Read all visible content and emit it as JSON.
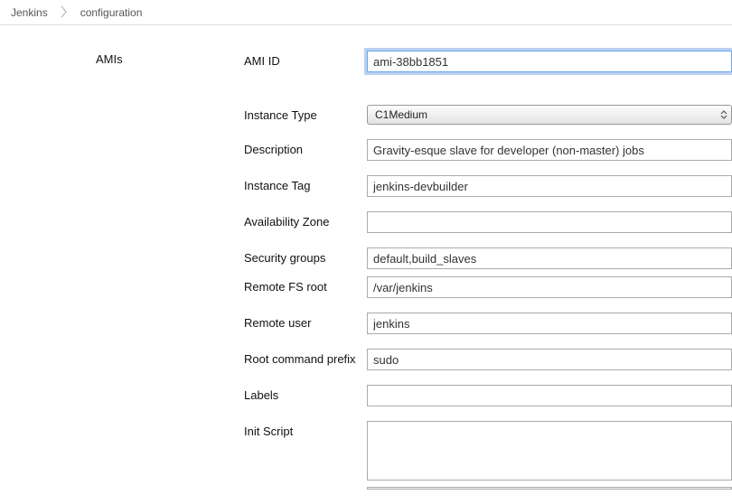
{
  "breadcrumb": {
    "root": "Jenkins",
    "page": "configuration"
  },
  "section_label": "AMIs",
  "fields": {
    "ami_id": {
      "label": "AMI ID",
      "value": "ami-38bb1851"
    },
    "instance_type": {
      "label": "Instance Type",
      "selected": "C1Medium"
    },
    "description": {
      "label": "Description",
      "value": "Gravity-esque slave for developer (non-master) jobs"
    },
    "instance_tag": {
      "label": "Instance Tag",
      "value": "jenkins-devbuilder"
    },
    "availability_zone": {
      "label": "Availability Zone",
      "value": ""
    },
    "security_groups": {
      "label": "Security groups",
      "value": "default,build_slaves"
    },
    "remote_fs_root": {
      "label": "Remote FS root",
      "value": "/var/jenkins"
    },
    "remote_user": {
      "label": "Remote user",
      "value": "jenkins"
    },
    "root_command_prefix": {
      "label": "Root command prefix",
      "value": "sudo"
    },
    "labels": {
      "label": "Labels",
      "value": ""
    },
    "init_script": {
      "label": "Init Script",
      "value": ""
    }
  }
}
